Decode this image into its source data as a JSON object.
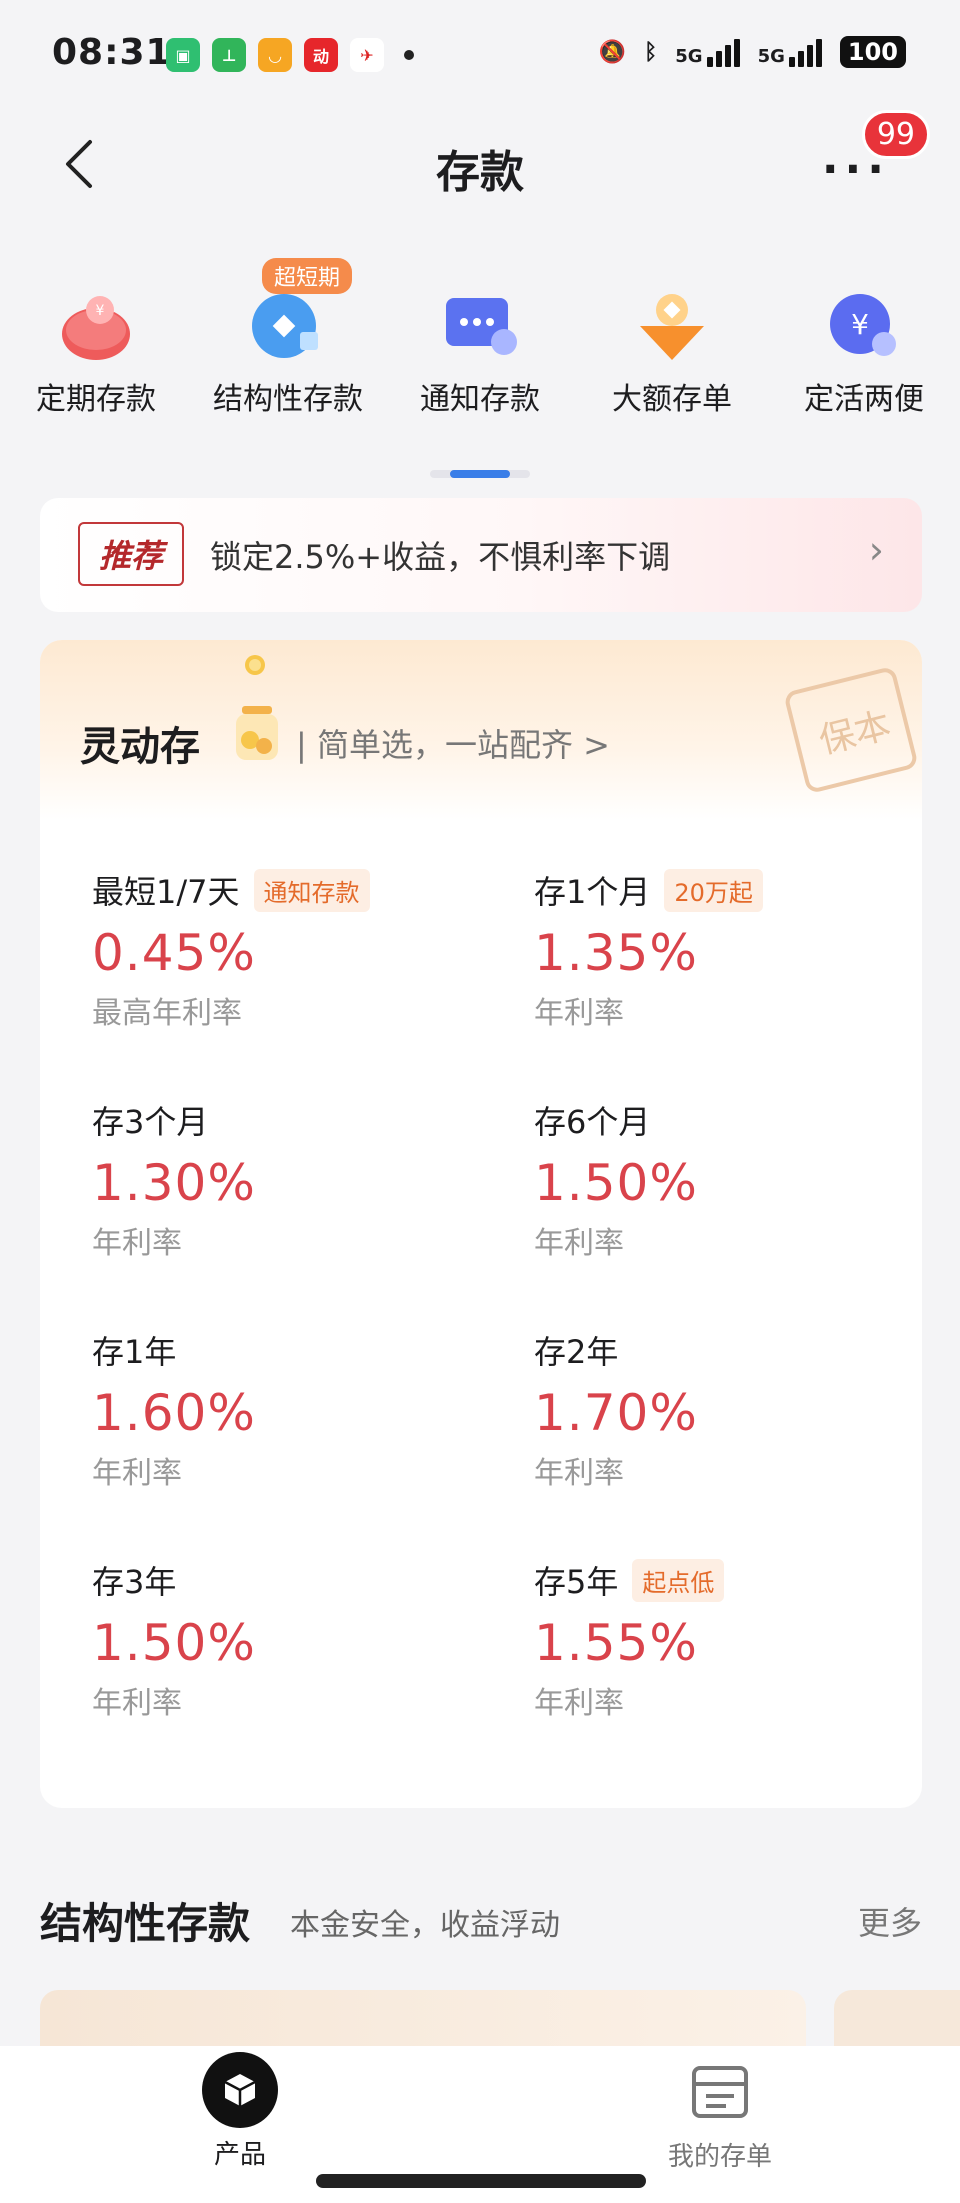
{
  "status": {
    "time": "08:31",
    "battery": "100",
    "network1": "5G",
    "network2": "5G",
    "app_icons": [
      "green-app",
      "green-app-2",
      "orange-app",
      "red-app",
      "airline-app"
    ]
  },
  "header": {
    "title": "存款",
    "more_badge": "99"
  },
  "categories": [
    {
      "label": "定期存款",
      "icon": "piggy-bank-icon"
    },
    {
      "label": "结构性存款",
      "icon": "structured-deposit-icon",
      "tag": "超短期"
    },
    {
      "label": "通知存款",
      "icon": "chat-bubble-icon"
    },
    {
      "label": "大额存单",
      "icon": "gold-bowl-icon"
    },
    {
      "label": "定活两便",
      "icon": "yuan-coin-icon"
    }
  ],
  "recommend": {
    "tag": "推荐",
    "text": "锁定2.5%+收益，不惧利率下调",
    "arrow": "›"
  },
  "flex_deposit": {
    "title": "灵动存",
    "subtitle": "| 简单选，一站配齐 >",
    "stamp": "保本",
    "items": [
      {
        "name": "最短1/7天",
        "chip": "通知存款",
        "rate": "0.45%",
        "rate_label": "最高年利率"
      },
      {
        "name": "存1个月",
        "chip": "20万起",
        "rate": "1.35%",
        "rate_label": "年利率"
      },
      {
        "name": "存3个月",
        "chip": "",
        "rate": "1.30%",
        "rate_label": "年利率"
      },
      {
        "name": "存6个月",
        "chip": "",
        "rate": "1.50%",
        "rate_label": "年利率"
      },
      {
        "name": "存1年",
        "chip": "",
        "rate": "1.60%",
        "rate_label": "年利率"
      },
      {
        "name": "存2年",
        "chip": "",
        "rate": "1.70%",
        "rate_label": "年利率"
      },
      {
        "name": "存3年",
        "chip": "",
        "rate": "1.50%",
        "rate_label": "年利率"
      },
      {
        "name": "存5年",
        "chip": "起点低",
        "rate": "1.55%",
        "rate_label": "年利率"
      }
    ]
  },
  "structured": {
    "title": "结构性存款",
    "subtitle": "本金安全，收益浮动",
    "more": "更多"
  },
  "tabbar": {
    "products": "产品",
    "my_deposits": "我的存单"
  },
  "colors": {
    "rate_red": "#d9434b",
    "chip_orange": "#e46b2b",
    "accent_blue": "#3a7ee8",
    "badge_red": "#e8333a"
  }
}
